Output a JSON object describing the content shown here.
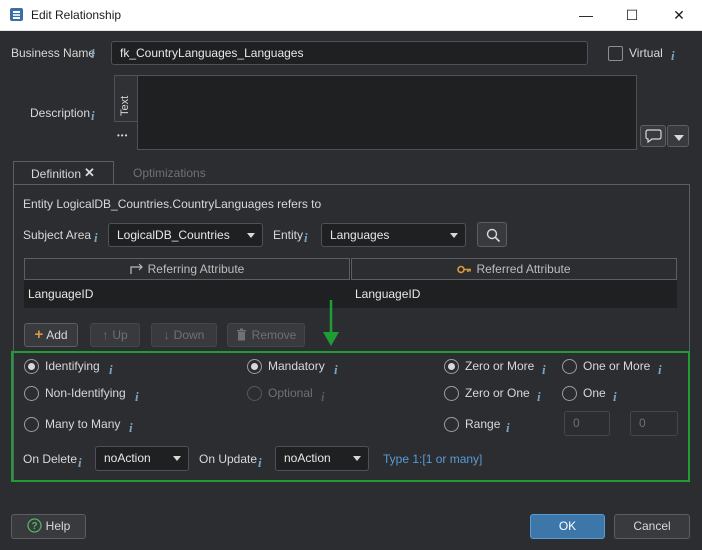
{
  "window": {
    "title": "Edit Relationship",
    "minimize_glyph": "—",
    "maximize_glyph": "☐",
    "close_glyph": "✕"
  },
  "info_glyph": "i",
  "business_name": {
    "label": "Business Name",
    "value": "fk_CountryLanguages_Languages"
  },
  "virtual": {
    "label": "Virtual",
    "checked": false
  },
  "description": {
    "label": "Description",
    "tab_label": "Text",
    "ellipsis": "•••",
    "value": ""
  },
  "tabs": [
    {
      "label": "Definition",
      "active": true
    },
    {
      "label": "Optimizations",
      "active": false
    }
  ],
  "definition": {
    "refers_text": "Entity LogicalDB_Countries.CountryLanguages refers to",
    "subject_area_label": "Subject Area",
    "subject_area_value": "LogicalDB_Countries",
    "entity_label": "Entity",
    "entity_value": "Languages",
    "grid": {
      "columns": [
        "Referring Attribute",
        "Referred Attribute"
      ],
      "rows": [
        [
          "LanguageID",
          "LanguageID"
        ]
      ]
    },
    "buttons": {
      "add": "Add",
      "up": "Up",
      "down": "Down",
      "remove": "Remove"
    }
  },
  "relationship_options": {
    "identifying": "Identifying",
    "non_identifying": "Non-Identifying",
    "many_to_many": "Many to Many",
    "mandatory": "Mandatory",
    "optional": "Optional",
    "zero_or_more": "Zero or More",
    "one_or_more": "One or More",
    "zero_or_one": "Zero or One",
    "one": "One",
    "range": "Range",
    "range_min": "0",
    "range_max": "0",
    "on_delete_label": "On Delete",
    "on_delete_value": "noAction",
    "on_update_label": "On Update",
    "on_update_value": "noAction",
    "cardinality_text": "Type 1:[1 or many]"
  },
  "footer": {
    "help": "Help",
    "ok": "OK",
    "cancel": "Cancel"
  },
  "colors": {
    "highlight_frame": "#1f9d35",
    "arrow": "#1f9d35",
    "accent": "#3d76a8",
    "link": "#5b9bd4"
  }
}
